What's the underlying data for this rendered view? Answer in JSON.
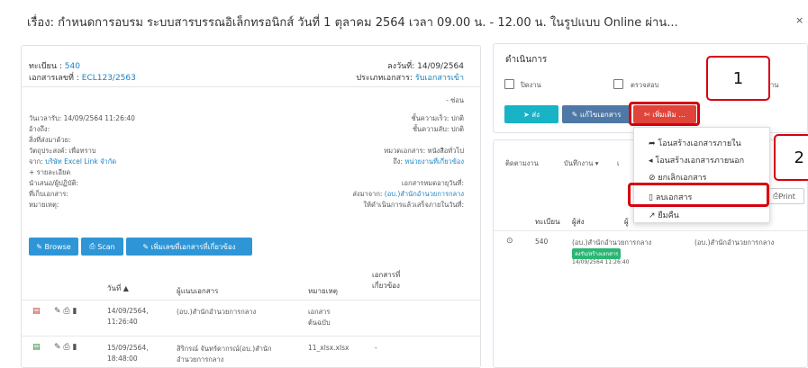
{
  "header": {
    "title": "เรื่อง: กำหนดการอบรม ระบบสารบรรณอิเล็กทรอนิกส์ วันที่ 1 ตุลาคม 2564 เวลา 09.00 น. - 12.00 น. ในรูปแบบ Online ผ่าน...",
    "close": "×"
  },
  "doc": {
    "reg_label": "ทะเบียน :",
    "reg_value": "540",
    "docno_label": "เอกสารเลขที่ :",
    "docno_value": "ECL123/2563",
    "date_label": "ลงวันที่: 14/09/2564",
    "type_label": "ประเภทเอกสาร:",
    "type_value": "รับเอกสารเข้า",
    "hide_link": "- ซ่อน",
    "received": "วันเวลารับ: 14/09/2564 11:26:40",
    "ref": "อ้างถึง:",
    "attach": "สิ่งที่ส่งมาด้วย:",
    "purpose": "วัตถุประสงค์: เพื่อทราบ",
    "from_label": "จาก:",
    "from_value": "บริษัท Excel Link จำกัด",
    "detail_link": "+ รายละเอียด",
    "present": "นำเสนอ/ผู้ปฏิบัติ:",
    "storage": "ที่เก็บเอกสาร:",
    "note": "หมายเหตุ:",
    "speed": "ชั้นความเร็ว: ปกติ",
    "secret": "ชั้นความลับ: ปกติ",
    "category": "หมวดเอกสาร: หนังสือทั่วไป",
    "to_label": "ถึง:",
    "to_value": "หน่วยงานที่เกี่ยวข้อง",
    "docdate": "เอกสารหมดอายุวันที่:",
    "sentfrom_label": "ส่งมาจาก:",
    "sentfrom_value": "(อบ.)สำนักอำนวยการกลาง",
    "deadline": "ให้ดำเนินการแล้วเสร็จภายในวันที่:"
  },
  "buttons": {
    "browse": "Browse",
    "scan": "Scan",
    "related": "เพิ่มเลขที่เอกสารที่เกี่ยวข้อง"
  },
  "table": {
    "headers": [
      "วันที่ ▲",
      "ผู้แนบเอกสาร",
      "หมายเหตุ",
      "เอกสารที่",
      "เกี่ยวข้อง"
    ],
    "rows": [
      {
        "date1": "14/09/2564,",
        "date2": "11:26:40",
        "by1": "(อบ.)สำนักอำนวยการกลาง",
        "by2": "",
        "note1": "เอกสาร",
        "note2": "ต้นฉบับ",
        "rel": ""
      },
      {
        "date1": "15/09/2564,",
        "date2": "18:48:00",
        "by1": "สิริกรณ์ จันทร์ดากรณ์(อบ.)สำนัก",
        "by2": "อำนวยการกลาง",
        "note1": "11_xlsx.xlsx",
        "note2": "",
        "rel": "-"
      }
    ]
  },
  "actions": {
    "title": "ดำเนินการ",
    "check_done": "ปิดงาน",
    "check_review": "ตรวจสอบ",
    "check_third": "าน",
    "send": "ส่ง",
    "edit": "แก้ไขเอกสาร",
    "more": "เพิ่มเติม ..."
  },
  "dropdown": {
    "items": [
      "โอนสร้างเอกสารภายใน",
      "โอนสร้างเอกสารภายนอก",
      "ยกเลิกเอกสาร",
      "ลบเอกสาร",
      "ยืมคืน"
    ]
  },
  "tracking": {
    "tabs": [
      "ติดตามงาน",
      "บันทึกงาน ▾",
      "เ"
    ],
    "print": "Print",
    "col_reg": "ทะเบียน",
    "col_sender": "ผู้ส่ง",
    "col_third": "ผู้",
    "row_reg": "540",
    "row_sender": "(อบ.)สำนักอำนวยการกลาง",
    "row_receiver": "(อบ.)สำนักอำนวยการกลาง",
    "row_tag": "ลงรับ/สร้างเอกสาร",
    "row_time": "14/09/2564 11:26:40"
  },
  "callouts": {
    "one": "1",
    "two": "2"
  },
  "colors": {
    "accent": "#1a82c4",
    "highlight": "#d6000f",
    "send": "#19b3c6",
    "more": "#e0443a"
  }
}
